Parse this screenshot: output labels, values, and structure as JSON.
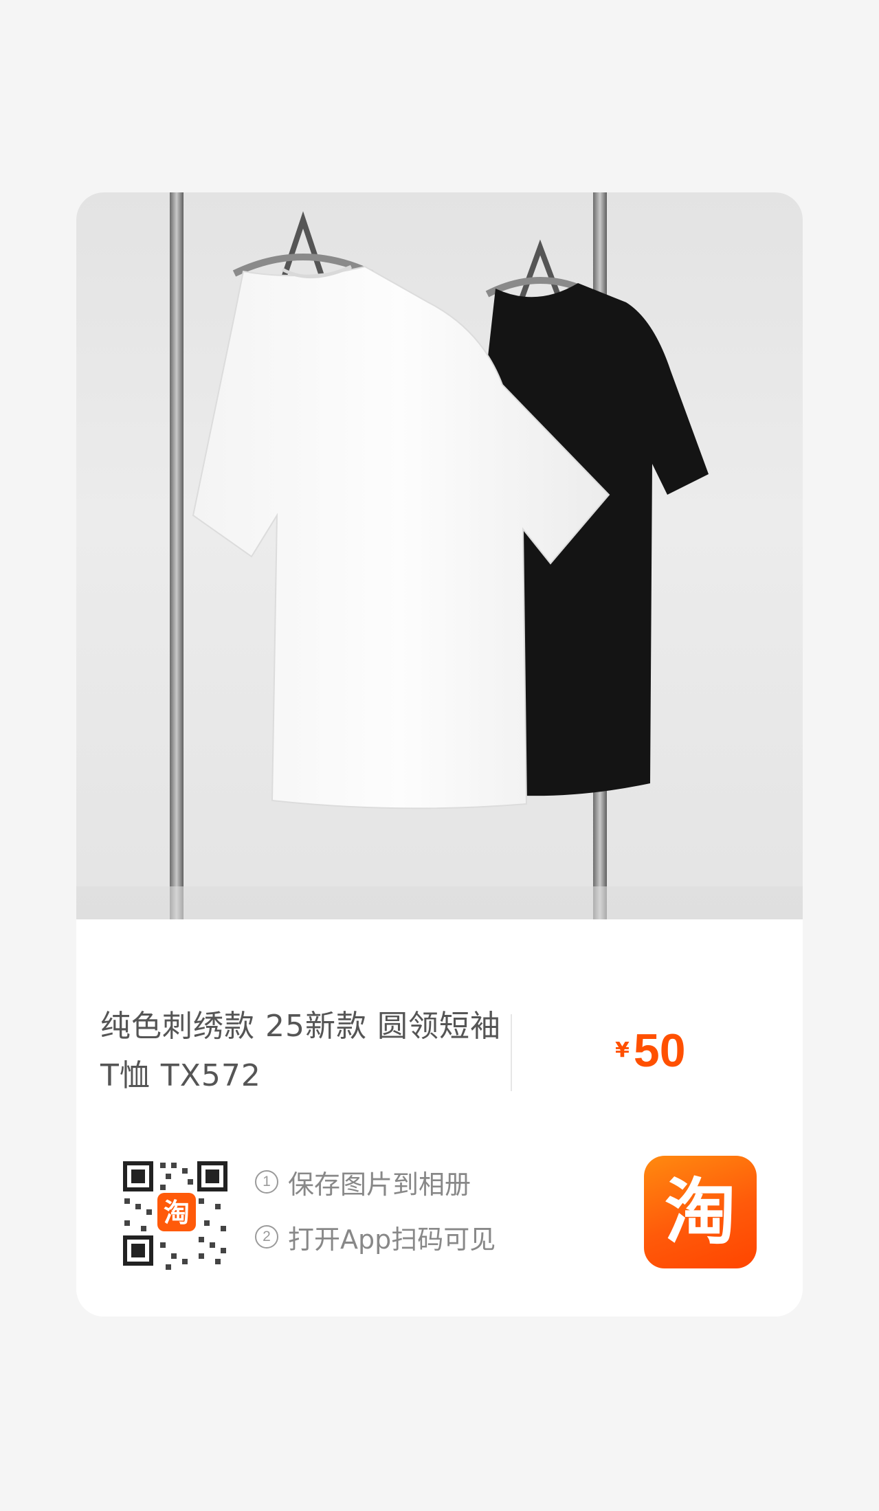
{
  "product": {
    "title": "纯色刺绣款 25新款 圆领短袖T恤 TX572",
    "currency": "¥",
    "price": "50"
  },
  "share": {
    "steps": [
      {
        "num": "1",
        "text": "保存图片到相册"
      },
      {
        "num": "2",
        "text": "打开App扫码可见"
      }
    ],
    "app_logo_text": "淘",
    "qr_center_text": "淘"
  },
  "colors": {
    "accent": "#ff5000",
    "text_primary": "#555555",
    "text_secondary": "#888888",
    "background": "#f5f5f5",
    "card": "#ffffff"
  },
  "icons": [
    "qr-code-icon",
    "taobao-app-icon"
  ]
}
